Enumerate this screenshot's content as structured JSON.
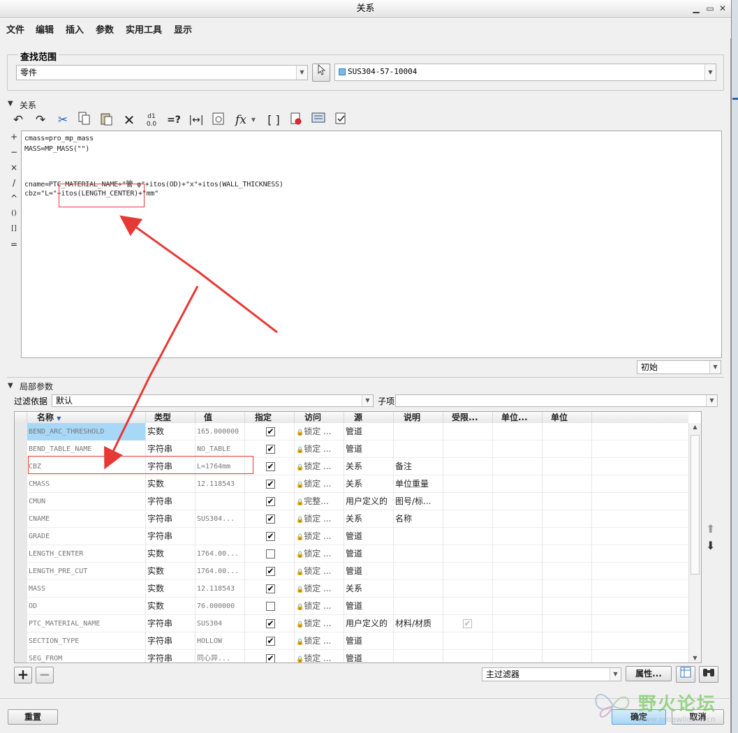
{
  "window": {
    "title": "关系",
    "min": "▁",
    "max": "▭",
    "close": "✕"
  },
  "menu": [
    "文件",
    "编辑",
    "插入",
    "参数",
    "实用工具",
    "显示"
  ],
  "scope": {
    "label": "查找范围",
    "type_value": "零件",
    "model_value": "SUS304-57-10004"
  },
  "relations": {
    "label": "关系",
    "ops": [
      "+",
      "−",
      "×",
      "/",
      "^",
      "()",
      "[]",
      "="
    ],
    "toolbar": {
      "fx": "fx"
    },
    "lines": [
      "cmass=pro_mp_mass",
      "MASS=MP_MASS(\"\")",
      "",
      "",
      "cname=PTC_MATERIAL_NAME+\"管 φ\"+itos(OD)+\"x\"+itos(WALL_THICKNESS)",
      "cbz=\"L≈\"+itos(LENGTH_CENTER)+\"mm\""
    ],
    "units_value": "初始"
  },
  "local_params": {
    "label": "局部参数",
    "filter_label": "过滤依据",
    "filter_value": "默认",
    "child_label": "子项",
    "columns": [
      "名称",
      "类型",
      "值",
      "指定",
      "访问",
      "源",
      "说明",
      "受限...",
      "单位...",
      "单位"
    ],
    "rows": [
      {
        "name": "BEND_ARC_THRESHOLD",
        "type": "实数",
        "value": "165.000000",
        "designate": true,
        "access": "锁定 ...",
        "source": "管道",
        "desc": "",
        "restricted": false
      },
      {
        "name": "BEND_TABLE_NAME",
        "type": "字符串",
        "value": "NO_TABLE",
        "designate": true,
        "access": "锁定 ...",
        "source": "管道",
        "desc": "",
        "restricted": false
      },
      {
        "name": "CBZ",
        "type": "字符串",
        "value": "L≈1764mm",
        "designate": true,
        "access": "锁定 ...",
        "source": "关系",
        "desc": "备注",
        "restricted": false
      },
      {
        "name": "CMASS",
        "type": "实数",
        "value": "12.118543",
        "designate": true,
        "access": "锁定 ...",
        "source": "关系",
        "desc": "单位重量",
        "restricted": false
      },
      {
        "name": "CMUN",
        "type": "字符串",
        "value": "",
        "designate": true,
        "access": "完整...",
        "source": "用户定义的",
        "desc": "图号/标...",
        "restricted": false
      },
      {
        "name": "CNAME",
        "type": "字符串",
        "value": "SUS304...",
        "designate": true,
        "access": "锁定 ...",
        "source": "关系",
        "desc": "名称",
        "restricted": false
      },
      {
        "name": "GRADE",
        "type": "字符串",
        "value": "",
        "designate": true,
        "access": "锁定 ...",
        "source": "管道",
        "desc": "",
        "restricted": false
      },
      {
        "name": "LENGTH_CENTER",
        "type": "实数",
        "value": "1764.00...",
        "designate": false,
        "access": "锁定 ...",
        "source": "管道",
        "desc": "",
        "restricted": false
      },
      {
        "name": "LENGTH_PRE_CUT",
        "type": "实数",
        "value": "1764.00...",
        "designate": true,
        "access": "锁定 ...",
        "source": "管道",
        "desc": "",
        "restricted": false
      },
      {
        "name": "MASS",
        "type": "实数",
        "value": "12.118543",
        "designate": true,
        "access": "锁定 ...",
        "source": "关系",
        "desc": "",
        "restricted": false
      },
      {
        "name": "OD",
        "type": "实数",
        "value": "76.000000",
        "designate": false,
        "access": "锁定 ...",
        "source": "管道",
        "desc": "",
        "restricted": false
      },
      {
        "name": "PTC_MATERIAL_NAME",
        "type": "字符串",
        "value": "SUS304",
        "designate": true,
        "access": "锁定 ...",
        "source": "用户定义的",
        "desc": "材料/材质",
        "restricted": true
      },
      {
        "name": "SECTION_TYPE",
        "type": "字符串",
        "value": "HOLLOW",
        "designate": true,
        "access": "锁定 ...",
        "source": "管道",
        "desc": "",
        "restricted": false
      },
      {
        "name": "SEG_FROM",
        "type": "字符串",
        "value": "同心异...",
        "designate": true,
        "access": "锁定 ...",
        "source": "管道",
        "desc": "",
        "restricted": false
      }
    ],
    "main_filter": "主过滤器",
    "properties": "属性..."
  },
  "footer": {
    "reset": "重置",
    "ok": "确定",
    "cancel": "取消"
  },
  "watermark": {
    "text": "野火论坛",
    "url": "www.proewildfire.cn"
  },
  "colors": {
    "accent": "#a8d8f8",
    "annotation": "#e53935"
  }
}
